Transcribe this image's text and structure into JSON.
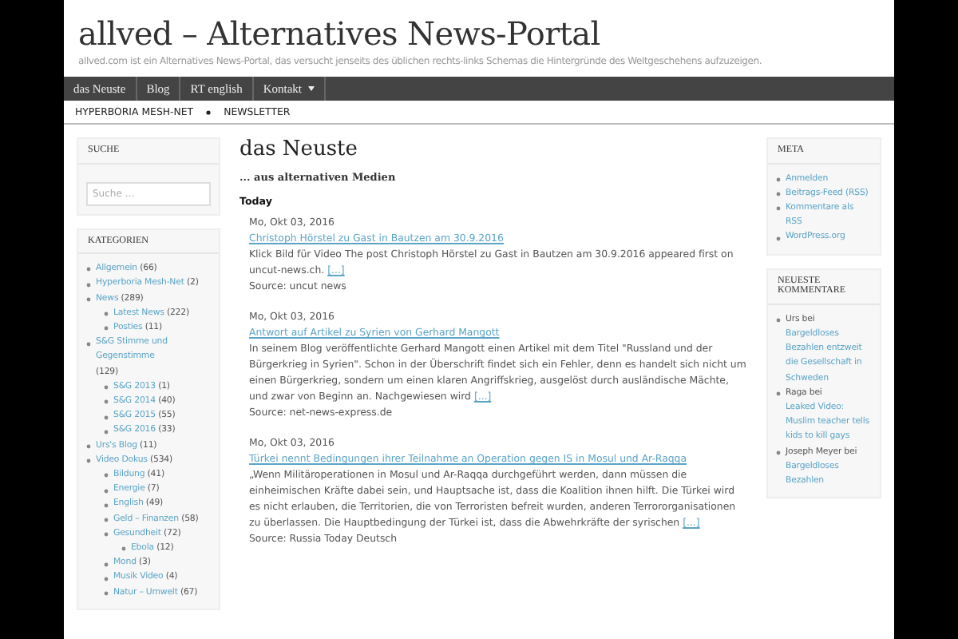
{
  "site": {
    "title": "allved – Alternatives News-Portal",
    "tagline": "allved.com ist ein Alternatives News-Portal, das versucht jenseits des üblichen rechts-links Schemas die Hintergründe des Weltgeschehens aufzuzeigen."
  },
  "nav": [
    {
      "label": "das Neuste",
      "dropdown": false
    },
    {
      "label": "Blog",
      "dropdown": false
    },
    {
      "label": "RT english",
      "dropdown": false
    },
    {
      "label": "Kontakt",
      "dropdown": true
    }
  ],
  "subnav": [
    "HYPERBORIA MESH-NET",
    "NEWSLETTER"
  ],
  "search_widget": {
    "title": "SUCHE",
    "placeholder": "Suche …"
  },
  "categories_widget": {
    "title": "KATEGORIEN",
    "items": [
      {
        "name": "Allgemein",
        "count": "(66)"
      },
      {
        "name": "Hyperboria Mesh-Net",
        "count": "(2)"
      },
      {
        "name": "News",
        "count": "(289)",
        "children": [
          {
            "name": "Latest News",
            "count": "(222)"
          },
          {
            "name": "Posties",
            "count": "(11)"
          }
        ]
      },
      {
        "name": "S&G Stimme und Gegenstimme",
        "count": "(129)",
        "children": [
          {
            "name": "S&G 2013",
            "count": "(1)"
          },
          {
            "name": "S&G 2014",
            "count": "(40)"
          },
          {
            "name": "S&G 2015",
            "count": "(55)"
          },
          {
            "name": "S&G 2016",
            "count": "(33)"
          }
        ]
      },
      {
        "name": "Urs's Blog",
        "count": "(11)"
      },
      {
        "name": "Video Dokus",
        "count": "(534)",
        "children": [
          {
            "name": "Bildung",
            "count": "(41)"
          },
          {
            "name": "Energie",
            "count": "(7)"
          },
          {
            "name": "English",
            "count": "(49)"
          },
          {
            "name": "Geld – Finanzen",
            "count": "(58)"
          },
          {
            "name": "Gesundheit",
            "count": "(72)",
            "children": [
              {
                "name": "Ebola",
                "count": "(12)"
              }
            ]
          },
          {
            "name": "Mond",
            "count": "(3)"
          },
          {
            "name": "Musik Video",
            "count": "(4)"
          },
          {
            "name": "Natur – Umwelt",
            "count": "(67)"
          }
        ]
      }
    ]
  },
  "main": {
    "heading": "das Neuste",
    "subheading": "... aus alternativen Medien",
    "group": "Today",
    "posts": [
      {
        "date": "Mo, Okt 03, 2016",
        "title": "Christoph Hörstel zu Gast in Bautzen am 30.9.2016",
        "excerpt": "Klick Bild für Video The post Christoph Hörstel zu Gast in Bautzen am 30.9.2016 appeared first on uncut-news.ch.",
        "more": "[...]",
        "source": "Source: uncut news"
      },
      {
        "date": "Mo, Okt 03, 2016",
        "title": "Antwort auf Artikel zu Syrien von Gerhard Mangott",
        "excerpt": "In seinem Blog veröffentlichte Gerhard Mangott einen Artikel mit dem Titel \"Russland und der Bürgerkrieg in Syrien\". Schon in der Überschrift findet sich ein Fehler, denn es handelt sich nicht um einen Bürgerkrieg, sondern um einen klaren Angriffskrieg, ausgelöst durch ausländische Mächte, und zwar von Beginn an. Nachgewiesen wird",
        "more": "[...]",
        "source": "Source: net-news-express.de"
      },
      {
        "date": "Mo, Okt 03, 2016",
        "title": "Türkei nennt Bedingungen ihrer Teilnahme an Operation gegen IS in Mosul und Ar-Raqqa",
        "excerpt": "„Wenn Militäroperationen in Mosul und Ar-Raqqa durchgeführt werden, dann müssen die einheimischen Kräfte dabei sein, und Hauptsache ist, dass die Koalition ihnen hilft. Die Türkei wird es nicht erlauben, die Territorien, die von Terroristen befreit wurden, anderen Terrororganisationen zu überlassen. Die Hauptbedingung der Türkei ist, dass die Abwehrkräfte der syrischen",
        "more": "[...]",
        "source": "Source: Russia Today Deutsch"
      }
    ]
  },
  "meta_widget": {
    "title": "META",
    "links": [
      "Anmelden",
      "Beitrags-Feed (RSS)",
      "Kommentare als RSS",
      "WordPress.org"
    ]
  },
  "comments_widget": {
    "title": "NEUESTE KOMMENTARE",
    "items": [
      {
        "author": "Urs bei",
        "post": "Bargeldloses Bezahlen entzweit die Gesellschaft in Schweden"
      },
      {
        "author": "Raga bei",
        "post": "Leaked Video: Muslim teacher tells kids to kill gays"
      },
      {
        "author": "Joseph Meyer bei",
        "post": "Bargeldloses Bezahlen"
      }
    ]
  }
}
